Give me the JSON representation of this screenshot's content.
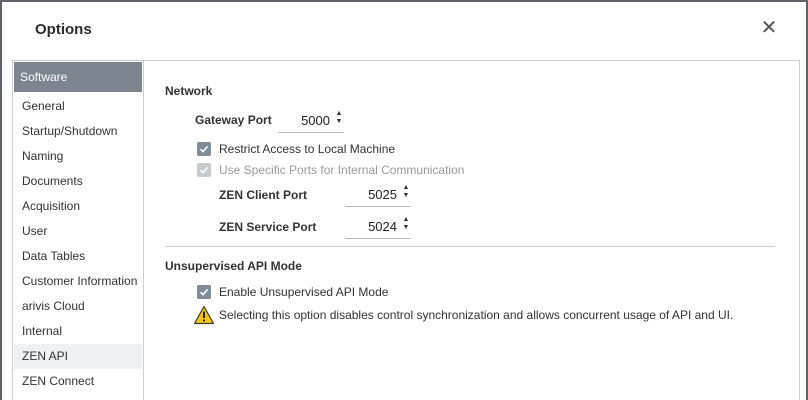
{
  "dialog": {
    "title": "Options",
    "close_glyph": "✕"
  },
  "sidebar": {
    "header": "Software",
    "items": [
      {
        "label": "General"
      },
      {
        "label": "Startup/Shutdown"
      },
      {
        "label": "Naming"
      },
      {
        "label": "Documents"
      },
      {
        "label": "Acquisition"
      },
      {
        "label": "User"
      },
      {
        "label": "Data Tables"
      },
      {
        "label": "Customer Information"
      },
      {
        "label": "arivis Cloud"
      },
      {
        "label": "Internal"
      },
      {
        "label": "ZEN API",
        "selected": true
      },
      {
        "label": "ZEN Connect"
      }
    ]
  },
  "network": {
    "section_title": "Network",
    "gateway_port": {
      "label": "Gateway Port",
      "value": "5000"
    },
    "restrict_access": {
      "label": "Restrict Access to Local Machine",
      "checked": true,
      "enabled": true
    },
    "specific_ports": {
      "label": "Use Specific Ports for Internal Communication",
      "checked": true,
      "enabled": false
    },
    "zen_client_port": {
      "label": "ZEN Client Port",
      "value": "5025"
    },
    "zen_service_port": {
      "label": "ZEN Service Port",
      "value": "5024"
    }
  },
  "unsupervised": {
    "section_title": "Unsupervised API Mode",
    "enable": {
      "label": "Enable Unsupervised API Mode",
      "checked": true
    },
    "warning": "Selecting this option disables control synchronization and allows concurrent usage of API and UI."
  },
  "colors": {
    "sidebar_header_bg": "#7c8590",
    "checkbox": "#7f8b97",
    "warning_yellow": "#f5c400"
  }
}
